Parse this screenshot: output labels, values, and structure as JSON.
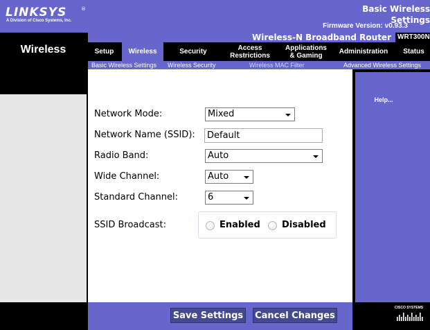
{
  "header": {
    "logo": "LINKSYS",
    "logo_reg": "®",
    "logo_sub": "A Division of Cisco Systems, Inc.",
    "firmware": "Firmware Version: v0.93.3"
  },
  "product": {
    "name": "Wireless-N Broadband Router",
    "model": "WRT300N"
  },
  "section_title": "Wireless",
  "tabs": [
    {
      "label": "Setup"
    },
    {
      "label": "Wireless"
    },
    {
      "label": "Security"
    },
    {
      "label": "Access\nRestrictions"
    },
    {
      "label": "Applications\n& Gaming"
    },
    {
      "label": "Administration"
    },
    {
      "label": "Status"
    }
  ],
  "subtabs": [
    {
      "label": "Basic Wireless Settings"
    },
    {
      "label": "Wireless Security"
    },
    {
      "label": "Wireless MAC Filter"
    },
    {
      "label": "Advanced Wireless Settings"
    }
  ],
  "left": {
    "heading": "Basic Wireless Settings"
  },
  "form": {
    "network_mode": {
      "label": "Network Mode:",
      "value": "Mixed"
    },
    "ssid": {
      "label": "Network Name (SSID):",
      "value": "Default"
    },
    "radio_band": {
      "label": "Radio Band:",
      "value": "Auto"
    },
    "wide_channel": {
      "label": "Wide Channel:",
      "value": "Auto"
    },
    "standard_channel": {
      "label": "Standard Channel:",
      "value": "6"
    },
    "ssid_broadcast": {
      "label": "SSID Broadcast:",
      "enabled": "Enabled",
      "disabled": "Disabled"
    }
  },
  "help": {
    "link": "Help..."
  },
  "buttons": {
    "save": "Save Settings",
    "cancel": "Cancel Changes"
  },
  "footer": {
    "cisco": "CISCO SYSTEMS"
  },
  "colors": {
    "brand": "#6666cc",
    "dark": "#000000",
    "button": "#434a8f"
  }
}
